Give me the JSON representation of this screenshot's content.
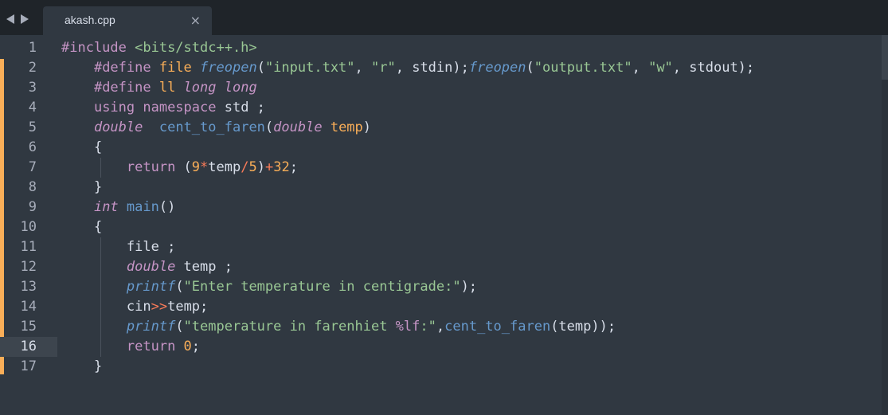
{
  "tab": {
    "title": "akash.cpp",
    "close": "×"
  },
  "icons": {
    "nav_back": "left-arrow",
    "nav_forward": "right-arrow"
  },
  "colors": {
    "background": "#303841",
    "tabbar": "#1f2429",
    "keyword": "#c594c5",
    "function": "#6699cc",
    "string": "#99c794",
    "number": "#f9ae58",
    "operator": "#f97b58",
    "modified_marker": "#f9ae58"
  },
  "editor": {
    "active_line": 16,
    "line_numbers": [
      "1",
      "2",
      "3",
      "4",
      "5",
      "6",
      "7",
      "8",
      "9",
      "10",
      "11",
      "12",
      "13",
      "14",
      "15",
      "16",
      "17"
    ],
    "lines": [
      [
        {
          "t": "#include ",
          "c": "kw-pre"
        },
        {
          "t": "<bits/stdc++.h>",
          "c": "hdr"
        }
      ],
      [
        {
          "t": "    "
        },
        {
          "t": "#define ",
          "c": "kw-pre"
        },
        {
          "t": "file ",
          "c": "param"
        },
        {
          "t": "freopen",
          "c": "fn-it"
        },
        {
          "t": "(",
          "c": "plain"
        },
        {
          "t": "\"input.txt\"",
          "c": "str"
        },
        {
          "t": ", ",
          "c": "plain"
        },
        {
          "t": "\"r\"",
          "c": "str"
        },
        {
          "t": ", stdin);",
          "c": "plain"
        },
        {
          "t": "freopen",
          "c": "fn-it"
        },
        {
          "t": "(",
          "c": "plain"
        },
        {
          "t": "\"output.txt\"",
          "c": "str"
        },
        {
          "t": ", ",
          "c": "plain"
        },
        {
          "t": "\"w\"",
          "c": "str"
        },
        {
          "t": ", stdout);",
          "c": "plain"
        }
      ],
      [
        {
          "t": "    "
        },
        {
          "t": "#define ",
          "c": "kw-pre"
        },
        {
          "t": "ll ",
          "c": "param"
        },
        {
          "t": "long long",
          "c": "kw-type"
        }
      ],
      [
        {
          "t": "    "
        },
        {
          "t": "using namespace ",
          "c": "kw-ctrl"
        },
        {
          "t": "std ;",
          "c": "plain"
        }
      ],
      [
        {
          "t": "    "
        },
        {
          "t": "double",
          "c": "kw-type"
        },
        {
          "t": "  "
        },
        {
          "t": "cent_to_faren",
          "c": "fn"
        },
        {
          "t": "(",
          "c": "plain"
        },
        {
          "t": "double ",
          "c": "kw-type"
        },
        {
          "t": "temp",
          "c": "param"
        },
        {
          "t": ")",
          "c": "plain"
        }
      ],
      [
        {
          "t": "    "
        },
        {
          "t": "{",
          "c": "plain"
        }
      ],
      [
        {
          "t": "        "
        },
        {
          "t": "return ",
          "c": "kw-ctrl"
        },
        {
          "t": "(",
          "c": "plain"
        },
        {
          "t": "9",
          "c": "num-lit"
        },
        {
          "t": "*",
          "c": "op"
        },
        {
          "t": "temp",
          "c": "plain"
        },
        {
          "t": "/",
          "c": "op"
        },
        {
          "t": "5",
          "c": "num-lit"
        },
        {
          "t": ")",
          "c": "plain"
        },
        {
          "t": "+",
          "c": "op"
        },
        {
          "t": "32",
          "c": "num-lit"
        },
        {
          "t": ";",
          "c": "plain"
        }
      ],
      [
        {
          "t": "    "
        },
        {
          "t": "}",
          "c": "plain"
        }
      ],
      [
        {
          "t": "    "
        },
        {
          "t": "int ",
          "c": "kw-type"
        },
        {
          "t": "main",
          "c": "fn"
        },
        {
          "t": "()",
          "c": "plain"
        }
      ],
      [
        {
          "t": "    "
        },
        {
          "t": "{",
          "c": "plain"
        }
      ],
      [
        {
          "t": "        "
        },
        {
          "t": "file ;",
          "c": "plain"
        }
      ],
      [
        {
          "t": "        "
        },
        {
          "t": "double ",
          "c": "kw-type"
        },
        {
          "t": "temp ;",
          "c": "plain"
        }
      ],
      [
        {
          "t": "        "
        },
        {
          "t": "printf",
          "c": "fn-it"
        },
        {
          "t": "(",
          "c": "plain"
        },
        {
          "t": "\"Enter temperature in centigrade:\"",
          "c": "str"
        },
        {
          "t": ");",
          "c": "plain"
        }
      ],
      [
        {
          "t": "        "
        },
        {
          "t": "cin",
          "c": "plain"
        },
        {
          "t": ">>",
          "c": "op"
        },
        {
          "t": "temp;",
          "c": "plain"
        }
      ],
      [
        {
          "t": "        "
        },
        {
          "t": "printf",
          "c": "fn-it"
        },
        {
          "t": "(",
          "c": "plain"
        },
        {
          "t": "\"temperature in farenhiet ",
          "c": "str"
        },
        {
          "t": "%lf",
          "c": "kw-pre"
        },
        {
          "t": ":\"",
          "c": "str"
        },
        {
          "t": ",",
          "c": "plain"
        },
        {
          "t": "cent_to_faren",
          "c": "fn"
        },
        {
          "t": "(temp));",
          "c": "plain"
        }
      ],
      [
        {
          "t": "        "
        },
        {
          "t": "return ",
          "c": "kw-ctrl"
        },
        {
          "t": "0",
          "c": "num-lit"
        },
        {
          "t": ";",
          "c": "plain"
        }
      ],
      [
        {
          "t": "    "
        },
        {
          "t": "}",
          "c": "plain"
        }
      ]
    ]
  }
}
